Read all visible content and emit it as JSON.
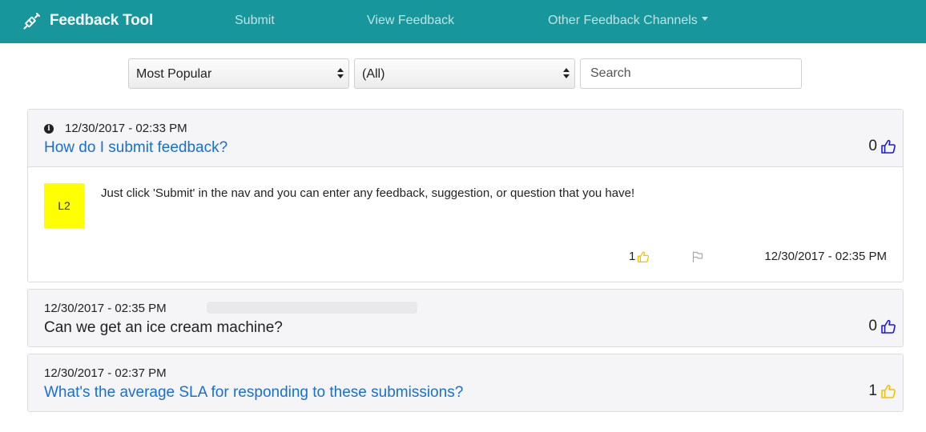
{
  "nav": {
    "brand": "Feedback Tool",
    "brand_icon": "syringe-icon",
    "links": [
      "Submit",
      "View Feedback",
      "Other Feedback Channels"
    ]
  },
  "filters": {
    "sort": "Most Popular",
    "category": "(All)",
    "search_placeholder": "Search"
  },
  "colors": {
    "navbar": "#17969b",
    "link": "#1670d1",
    "avatar": "#ffff00",
    "upvote_blue": "#1a1ad6",
    "upvote_yellow": "#f2c200"
  },
  "feedback": [
    {
      "date": "12/30/2017 - 02:33 PM",
      "title": "How do I submit feedback?",
      "votes": "0",
      "reply": {
        "avatar": "L2",
        "text": "Just click 'Submit' in the nav and you can enter any feedback, suggestion, or question that you have!",
        "likes": "1",
        "date": "12/30/2017 - 02:35 PM"
      }
    },
    {
      "date": "12/30/2017 - 02:35 PM",
      "title": "Can we get an ice cream machine?",
      "votes": "0"
    },
    {
      "date": "12/30/2017 - 02:37 PM",
      "title": "What's the average SLA for responding to these submissions?",
      "votes": "1"
    }
  ]
}
